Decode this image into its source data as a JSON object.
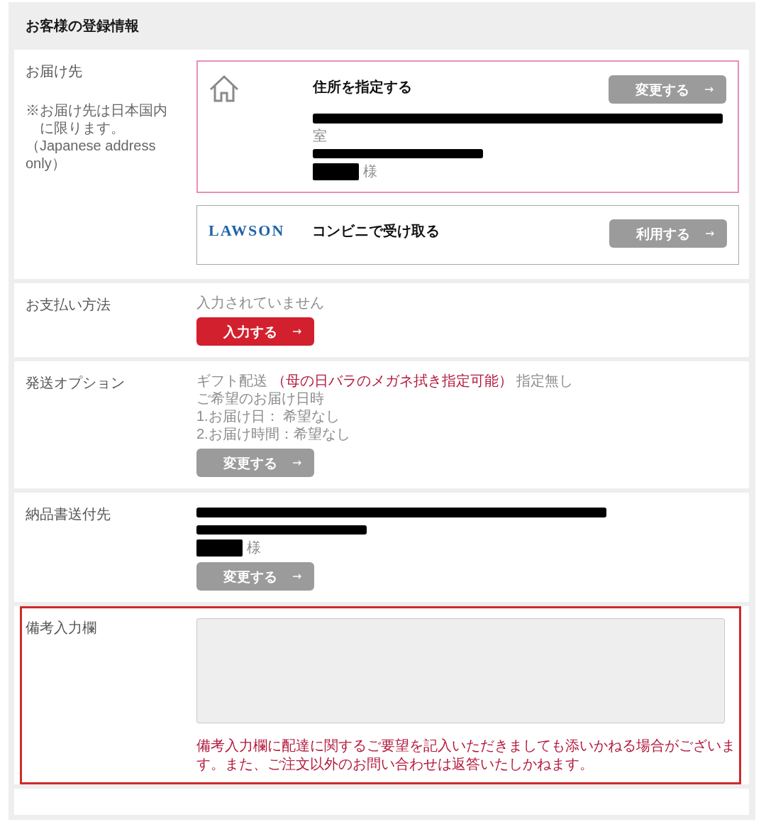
{
  "heading": {
    "title": "お客様の登録情報"
  },
  "sections": [
    {
      "kind": "entry",
      "label": "お届け先",
      "notes": [
        {
          "kind": "hanging",
          "text": "※お届け先は日本国内に限ります。"
        },
        {
          "kind": "plain",
          "text": "（Japanese address only）"
        }
      ],
      "highlighted": false,
      "options": [
        {
          "kind": "address",
          "title": "住所を指定する",
          "selected": true,
          "button": {
            "label": "変更する",
            "kind": "secondary"
          },
          "lines": [
            {
              "kind": "bar"
            },
            {
              "kind": "text",
              "text": "室"
            },
            {
              "kind": "halfbar"
            },
            {
              "kind": "block",
              "suffix": "様"
            }
          ]
        },
        {
          "kind": "store",
          "logo": "LAWSON",
          "title": "コンビニで受け取る",
          "selected": false,
          "button": {
            "label": "利用する",
            "kind": "secondary"
          }
        }
      ]
    },
    {
      "kind": "entry",
      "label": "お支払い方法",
      "highlighted": false,
      "lines": [
        {
          "kind": "text",
          "text": "入力されていません"
        }
      ],
      "button": {
        "label": "入力する",
        "kind": "primary"
      }
    },
    {
      "kind": "entry",
      "label": "発送オプション",
      "highlighted": false,
      "lines": [
        {
          "kind": "parts",
          "parts": [
            {
              "text": "ギフト配送",
              "emphasis": false
            },
            {
              "text": "（母の日バラのメガネ拭き指定可能）",
              "emphasis": true
            },
            {
              "text": "指定無し",
              "emphasis": false
            }
          ]
        },
        {
          "kind": "text",
          "text": "ご希望のお届け日時"
        },
        {
          "kind": "text",
          "text": "1.お届け日： 希望なし"
        },
        {
          "kind": "text",
          "text": "2.お届け時間：希望なし"
        }
      ],
      "button": {
        "label": "変更する",
        "kind": "secondary"
      }
    },
    {
      "kind": "entry",
      "label": "納品書送付先",
      "highlighted": false,
      "lines": [
        {
          "kind": "bar"
        },
        {
          "kind": "halfbar"
        },
        {
          "kind": "block",
          "suffix": "様"
        }
      ],
      "button": {
        "label": "変更する",
        "kind": "secondary"
      }
    },
    {
      "kind": "entry",
      "label": "備考入力欄",
      "highlighted": true,
      "text_area": true,
      "notice": "備考入力欄に配達に関するご要望を記入いただきましても添いかねる場合がございます。また、ご注文以外のお問い合わせは返答いたしかねます。"
    },
    {
      "kind": "spacer"
    }
  ]
}
